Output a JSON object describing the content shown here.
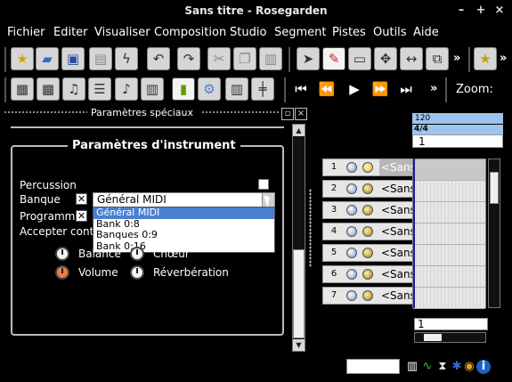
{
  "window": {
    "title": "Sans titre - Rosegarden"
  },
  "menu": [
    "Fichier",
    "Editer",
    "Visualiser",
    "Composition",
    "Studio",
    "Segment",
    "Pistes",
    "Outils",
    "Aide"
  ],
  "toolbar": {
    "zoom_label": "Zoom:",
    "more": "»"
  },
  "panel": {
    "title": "Paramètres spéciaux",
    "group_title": "Paramètres d'instrument",
    "percussion_label": "Percussion",
    "bank_label": "Banque",
    "program_label": "Programme",
    "accept_label": "Accepter contrô",
    "bank_value": "Général MIDI",
    "bank_options": [
      "Général MIDI",
      "Bank 0:8",
      "Banques 0:9",
      "Bank 0:16"
    ],
    "knobs": {
      "balance": "Balance",
      "chorus": "Chœur",
      "volume": "Volume",
      "reverb": "Réverbération"
    }
  },
  "ruler": {
    "tempo": "120",
    "time_signature": "4/4",
    "bar": "1"
  },
  "tracks": [
    {
      "number": "1",
      "name": "<Sans"
    },
    {
      "number": "2",
      "name": "<Sans"
    },
    {
      "number": "3",
      "name": "<Sans"
    },
    {
      "number": "4",
      "name": "<Sans"
    },
    {
      "number": "5",
      "name": "<Sans"
    },
    {
      "number": "6",
      "name": "<Sans"
    },
    {
      "number": "7",
      "name": "<Sans"
    }
  ],
  "bottom": {
    "bar": "1"
  }
}
